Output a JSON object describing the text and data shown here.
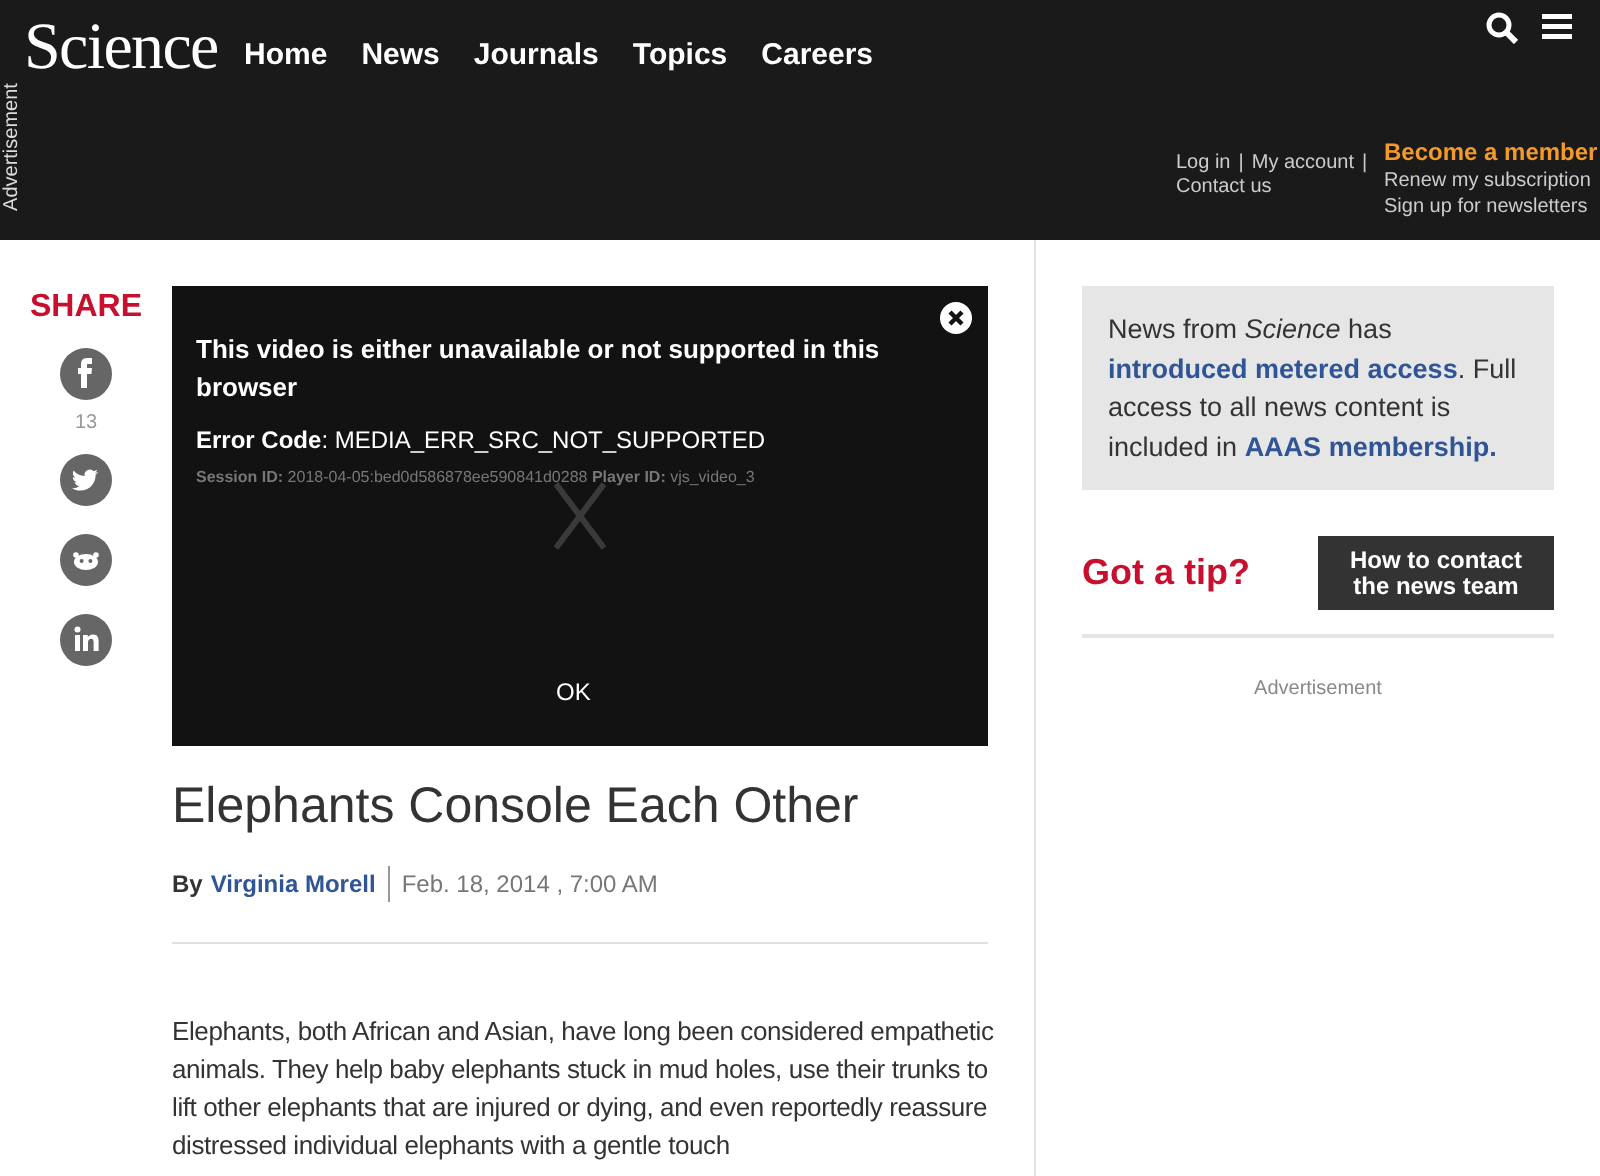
{
  "header": {
    "logo": "Science",
    "nav": [
      "Home",
      "News",
      "Journals",
      "Topics",
      "Careers"
    ],
    "ad_label": "Advertisement",
    "account_links": [
      "Log in",
      "My account",
      "Contact us"
    ],
    "account_separator": "|",
    "member": {
      "title": "Become a member",
      "links": [
        "Renew my subscription",
        "Sign up for newsletters"
      ]
    }
  },
  "share": {
    "title": "SHARE",
    "items": [
      {
        "kind": "facebook",
        "count": "13"
      },
      {
        "kind": "twitter"
      },
      {
        "kind": "reddit"
      },
      {
        "kind": "linkedin"
      }
    ]
  },
  "video_error": {
    "message": "This video is either unavailable or not supported in this browser",
    "error_code": "**Error Code**: MEDIA_ERR_SRC_NOT_SUPPORTED",
    "session": "**Session ID:** 2018-04-05:bed0d586878ee590841d0288 **Player ID:** vjs_video_3",
    "button": "OK"
  },
  "article": {
    "title": "Elephants Console Each Other",
    "by": "By",
    "author": "Virginia Morell",
    "date": "Feb. 18, 2014 , 7:00 AM",
    "body": "Elephants, both African and Asian, have long been considered empathetic animals. They help baby elephants stuck in mud holes, use their trunks to lift other elephants that are injured or dying, and even reportedly reassure distressed individual elephants with a gentle touch"
  },
  "sidebar": {
    "notice": [
      "News from ",
      "*Science*",
      " has ",
      "introduced metered access",
      ". Full access to all news content is included in ",
      "AAAS membership."
    ],
    "tip_title": "Got a tip?",
    "tip_button": "How to contact the news team",
    "ad_label": "Advertisement"
  }
}
